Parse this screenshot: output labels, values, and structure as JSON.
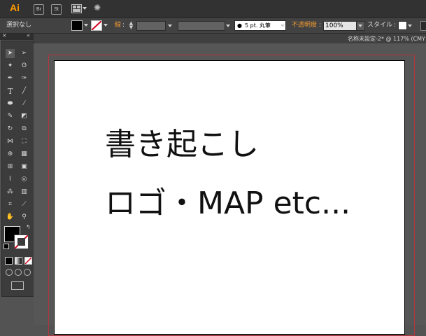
{
  "menubar": {
    "app_logo": "Ai",
    "bridge_label": "Br",
    "stock_label": "St"
  },
  "controlbar": {
    "selection_label": "選択なし",
    "stroke_label": "線",
    "brush_label": "5 pt. 丸筆",
    "opacity_label": "不透明度",
    "opacity_value": "100%",
    "style_label": "スタイル"
  },
  "document": {
    "tab_title": "名称未設定-2* @ 117% (CMY"
  },
  "artboard": {
    "line1": "書き起こし",
    "line2": "ロゴ・MAP etc..."
  },
  "icons": {
    "colors": {
      "accent": "#ff9a00",
      "bleed": "#b5343d",
      "fill": "#000000"
    }
  }
}
